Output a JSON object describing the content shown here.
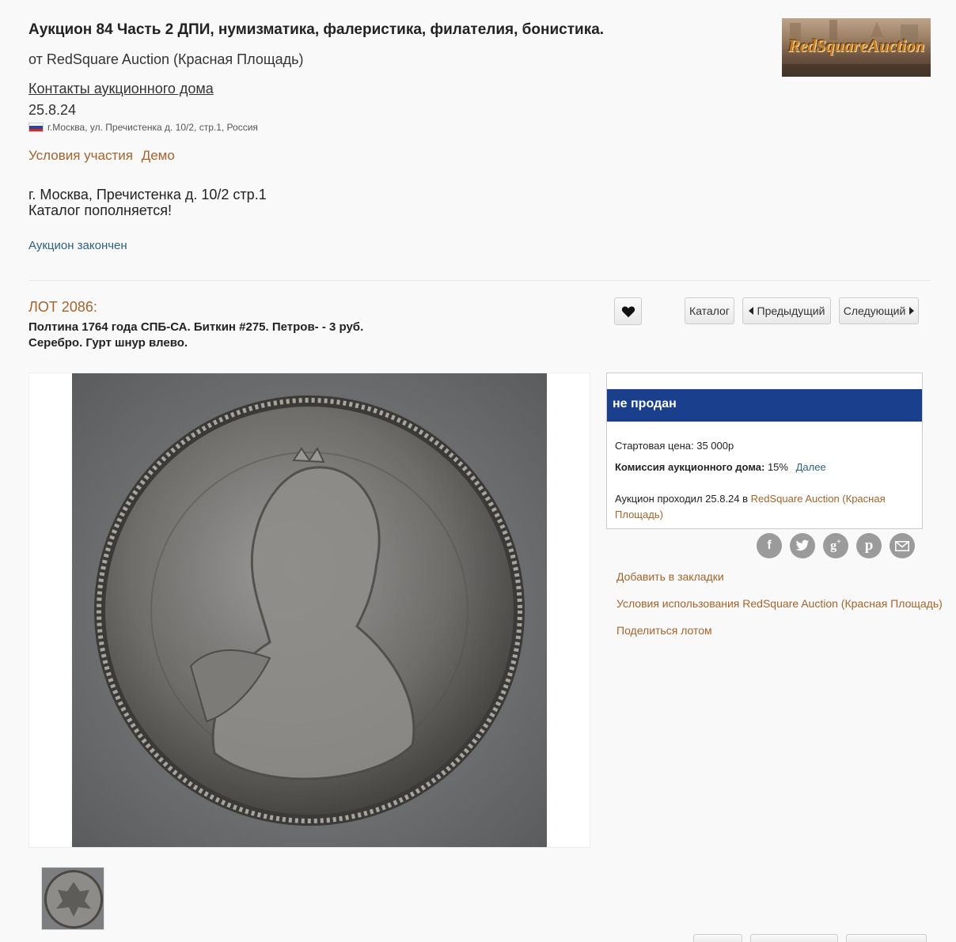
{
  "header": {
    "title": "Аукцион 84 Часть 2 ДПИ, нумизматика, фалеристика, филателия, бонистика.",
    "from": "от RedSquare Auction (Красная Площадь)",
    "contacts_link": "Контакты аукционного дома",
    "date": "25.8.24",
    "address": "г.Москва, ул. Пречистенка д. 10/2, стр.1, Россия",
    "conditions_link": "Условия участия",
    "demo_link": "Демо",
    "description_line1": "г. Москва, Пречистенка д. 10/2 стр.1",
    "description_line2": "Каталог пополняется!",
    "status_link": "Аукцион закончен",
    "logo_text": "RedSquareAuction"
  },
  "lot": {
    "number": "ЛОТ 2086:",
    "title": "Полтина 1764 года СПБ-СА. Биткин #275. Петров- - 3 руб. Серебро. Гурт шнур влево.",
    "fav_icon": "heart-icon",
    "catalog_btn": "Каталог",
    "prev_btn": "Предыдущий",
    "next_btn": "Следующий"
  },
  "panel": {
    "status": "не продан",
    "start_label": "Стартовая цена:",
    "start_value": "35 000р",
    "commission_label": "Комиссия аукционного дома:",
    "commission_value": "15%",
    "commission_more": "Далее",
    "held_prefix": "Аукцион проходил 25.8.24 в",
    "held_link": "RedSquare Auction (Красная Площадь)",
    "status_color": "#1a3f8c"
  },
  "social": [
    "facebook-icon",
    "twitter-icon",
    "google-plus-icon",
    "pinterest-icon",
    "email-icon"
  ],
  "side_links": {
    "bookmark": "Добавить в закладки",
    "terms": "Условия использования RedSquare Auction (Красная Площадь)",
    "share": "Поделиться лотом"
  },
  "colors": {
    "link_brown": "#a5632b",
    "link_blue": "#2c6080",
    "social_grey": "#9b9b9b"
  }
}
